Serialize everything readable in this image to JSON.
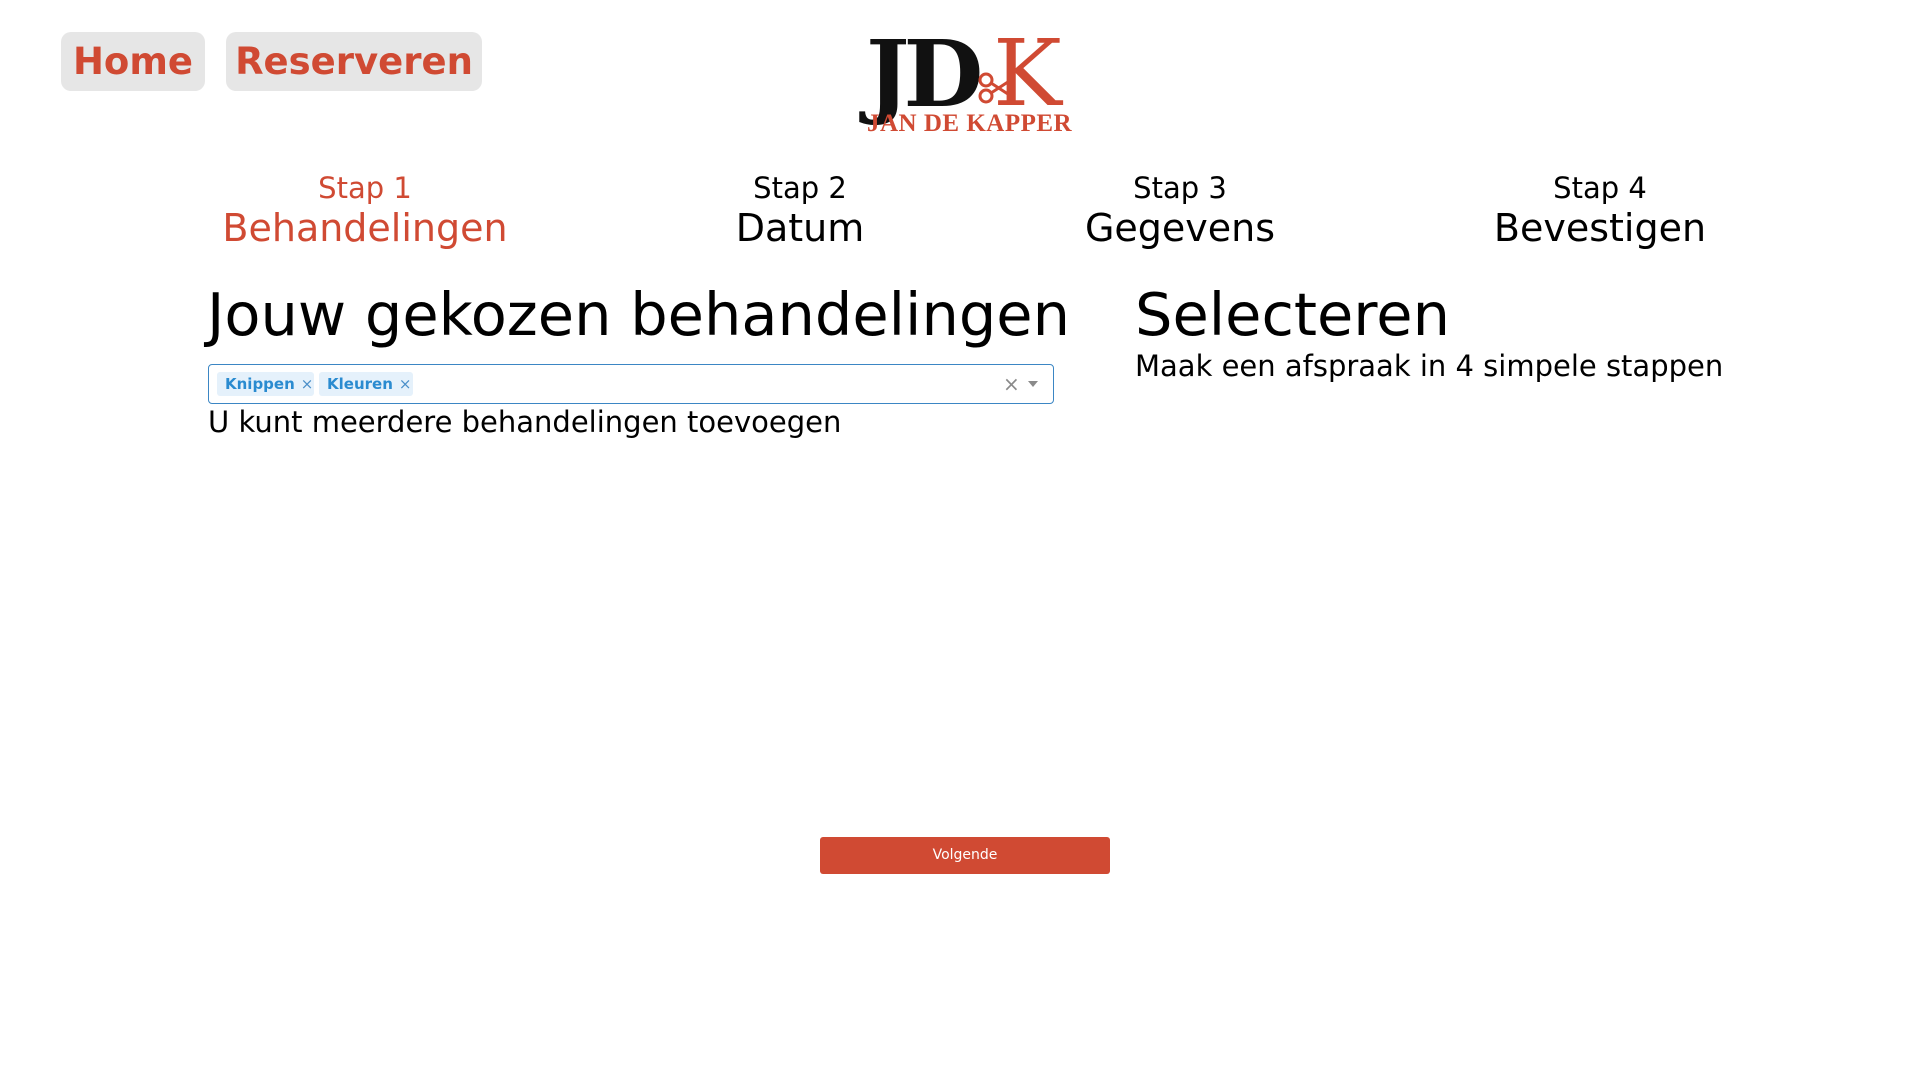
{
  "nav": {
    "home_label": "Home",
    "reserveren_label": "Reserveren"
  },
  "logo": {
    "letters_black": "JD",
    "letter_red": "K",
    "subtitle": "JAN DE KAPPER"
  },
  "steps": [
    {
      "num": "Stap 1",
      "name": "Behandelingen",
      "active": true
    },
    {
      "num": "Stap 2",
      "name": "Datum",
      "active": false
    },
    {
      "num": "Stap 3",
      "name": "Gegevens",
      "active": false
    },
    {
      "num": "Stap 4",
      "name": "Bevestigen",
      "active": false
    }
  ],
  "treatments": {
    "title": "Jouw gekozen behandelingen",
    "selected": [
      "Knippen",
      "Kleuren"
    ],
    "hint": "U kunt meerdere behandelingen toevoegen"
  },
  "select_panel": {
    "title": "Selecteren",
    "subtitle": "Maak een afspraak in 4 simpele stappen"
  },
  "next_button": {
    "label": "Volgende"
  },
  "colors": {
    "accent": "#d04a33",
    "chip_bg": "#e5f1fb",
    "chip_text": "#2a8bd0",
    "input_border": "#3b86c4",
    "nav_bg": "#e6e6e6"
  }
}
